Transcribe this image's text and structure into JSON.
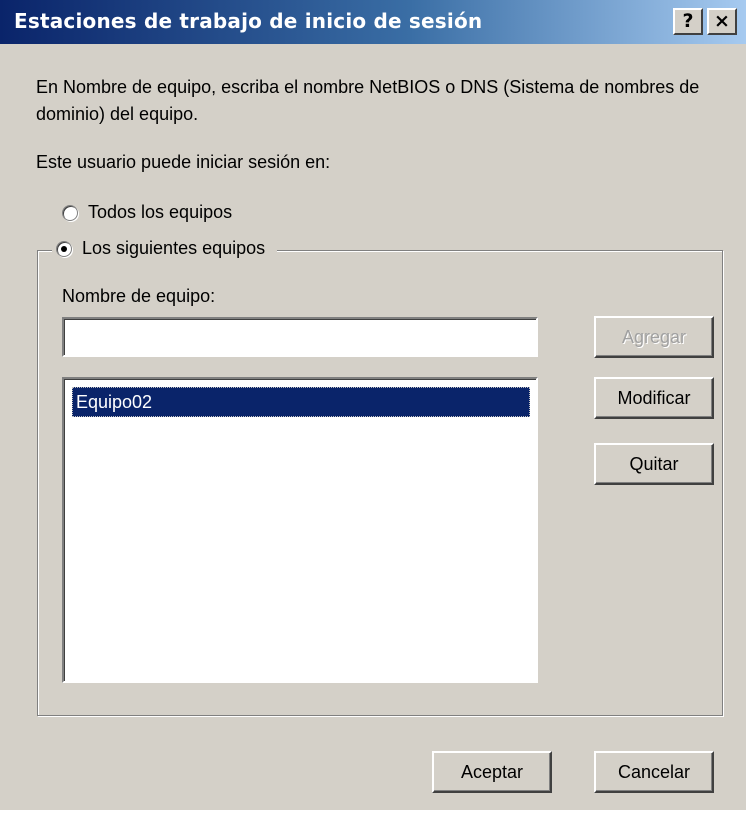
{
  "window": {
    "title": "Estaciones de trabajo de inicio de sesión",
    "help_label": "?",
    "close_label": "×"
  },
  "instructions": "En Nombre de equipo, escriba el nombre NetBIOS o DNS (Sistema de nombres de dominio) del equipo.",
  "user_can_logon_label": "Este usuario puede iniciar sesión en:",
  "options": {
    "all_computers": {
      "label": "Todos los equipos",
      "checked": false
    },
    "following_computers": {
      "label": "Los siguientes equipos",
      "checked": true
    }
  },
  "computer_name": {
    "label": "Nombre de equipo:",
    "value": ""
  },
  "computer_list": {
    "items": [
      "Equipo02"
    ],
    "selected": "Equipo02"
  },
  "buttons": {
    "add": {
      "label": "Agregar",
      "enabled": false
    },
    "edit": {
      "label": "Modificar",
      "enabled": true
    },
    "remove": {
      "label": "Quitar",
      "enabled": true
    },
    "ok": {
      "label": "Aceptar",
      "enabled": true
    },
    "cancel": {
      "label": "Cancelar",
      "enabled": true
    }
  }
}
